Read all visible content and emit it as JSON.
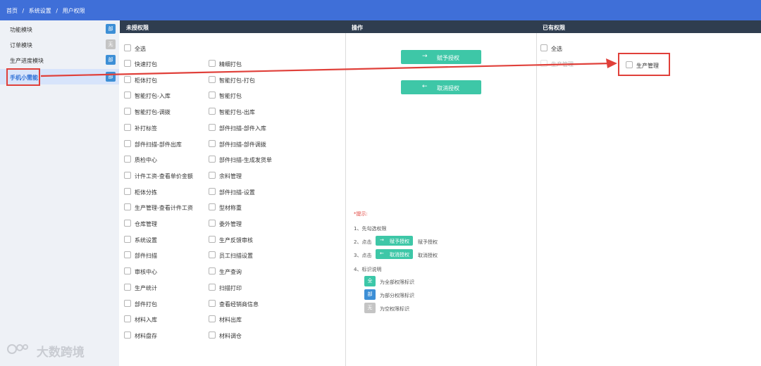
{
  "breadcrumb": [
    "首页",
    "系统设置",
    "用户权限"
  ],
  "breadcrumb_separator": "/",
  "sidebar": {
    "items": [
      {
        "label": "功能模块",
        "badge": "部",
        "badge_type": "part",
        "active": false
      },
      {
        "label": "订单模块",
        "badge": "无",
        "badge_type": "none",
        "active": false
      },
      {
        "label": "生产进度模块",
        "badge": "部",
        "badge_type": "part",
        "active": false
      },
      {
        "label": "手机小需能",
        "badge": "部",
        "badge_type": "part",
        "active": true
      }
    ]
  },
  "columns": {
    "unassigned": "未授权限",
    "operation": "操作",
    "assigned": "已有权限"
  },
  "unassigned": {
    "select_all": "全选",
    "left": [
      "快速打包",
      "柜体打包",
      "智能打包-入库",
      "智能打包-调拨",
      "补打标签",
      "部件扫描-部件出库",
      "质检中心",
      "计件工资-查看单价金额",
      "柜体分拣",
      "生产管理-查看计件工资",
      "仓库管理",
      "系统设置",
      "部件扫描",
      "审核中心",
      "生产统计",
      "部件打包",
      "材料入库",
      "材料盘存"
    ],
    "right": [
      "精细打包",
      "智能打包-打包",
      "智能打包",
      "智能打包-出库",
      "部件扫描-部件入库",
      "部件扫描-部件调拨",
      "部件扫描-生成发货单",
      "余料管理",
      "部件扫描-设置",
      "型材称重",
      "委外管理",
      "生产反馈审核",
      "员工扫描设置",
      "生产查询",
      "扫描打印",
      "查看经销商信息",
      "材料出库",
      "材料调仓"
    ]
  },
  "operation": {
    "grant_label": "赋予授权",
    "revoke_label": "取消授权",
    "hint_title": "*提示:",
    "step1": "1、先勾选权限",
    "step2_prefix": "2、点击",
    "step2_suffix": "赋予授权",
    "step3_prefix": "3、点击",
    "step3_suffix": "取消授权",
    "step4": "4、标识说明",
    "legend": [
      {
        "badge": "全",
        "type": "all",
        "text": "为全部权限标识"
      },
      {
        "badge": "部",
        "type": "part",
        "text": "为部分权限标识"
      },
      {
        "badge": "无",
        "type": "none",
        "text": "为空权限标识"
      }
    ]
  },
  "assigned": {
    "select_all": "全选",
    "items": [
      "生产管理"
    ],
    "hidden_label": "生产管理"
  },
  "watermark": "大数跨境",
  "colors": {
    "topbar": "#3f6fd8",
    "header": "#2f3d4f",
    "accent_green": "#3ec7a7",
    "badge_part": "#3d8fd6",
    "badge_none": "#c4c4c4",
    "highlight_red": "#e0403a"
  }
}
